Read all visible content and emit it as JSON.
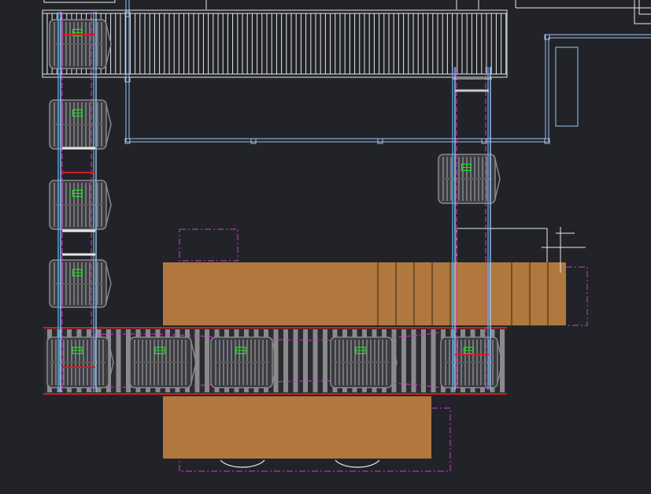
{
  "drawing": {
    "background": "#212329",
    "colors": {
      "line": "#e8e8e8",
      "wall": "#9ec6f0",
      "rail": "#5aa9e6",
      "magenta": "#d23ad2",
      "red": "#cc2020",
      "green": "#22e022",
      "gray": "#8a8a8a",
      "grayDark": "#5a5a5a",
      "wood": "#b0783e",
      "woodLine": "#3a2410"
    }
  }
}
